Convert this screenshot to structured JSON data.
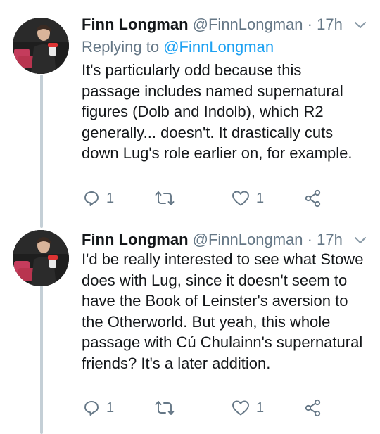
{
  "tweets": [
    {
      "name": "Finn Longman",
      "handle": "@FinnLongman",
      "separator": "·",
      "time": "17h",
      "replying_prefix": "Replying to ",
      "replying_handle": "@FinnLongman",
      "text": "It's particularly odd because this\npassage includes named supernatural\nfigures (Dolb and Indolb), which R2\ngenerally... doesn't. It drastically cuts\ndown Lug's role earlier on, for example.",
      "reply_count": "1",
      "like_count": "1"
    },
    {
      "name": "Finn Longman",
      "handle": "@FinnLongman",
      "separator": "·",
      "time": "17h",
      "text": "I'd be really interested to see what Stowe\ndoes with Lug, since it doesn't seem to\nhave the Book of Leinster's aversion to\nthe Otherworld. But yeah, this whole\npassage with Cú Chulainn's supernatural\nfriends? It's a later addition.",
      "reply_count": "1",
      "like_count": "1"
    }
  ],
  "icons": {
    "reply": "reply-icon",
    "retweet": "retweet-icon",
    "like": "heart-icon",
    "share": "share-icon",
    "menu": "chevron-down-icon"
  },
  "colors": {
    "text": "#14171a",
    "secondary": "#657786",
    "link": "#1da1f2",
    "thread_line": "#c4cfd6"
  }
}
